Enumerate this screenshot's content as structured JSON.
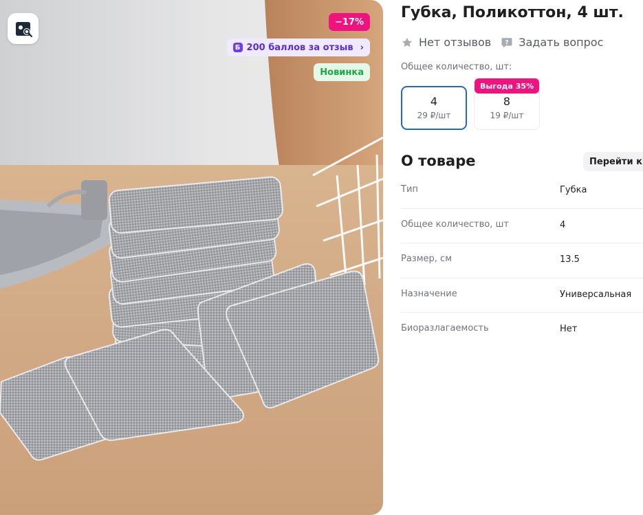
{
  "gallery": {
    "discount_badge": "−17%",
    "points_badge": {
      "icon_letter": "Б",
      "label": "200 баллов за отзыв",
      "chevron": "›"
    },
    "new_badge": "Новинка",
    "lens_icon": "image-search-icon"
  },
  "product": {
    "title": "Губка, Поликоттон, 4 шт.",
    "reviews_label": "Нет отзывов",
    "question_label": "Задать вопрос",
    "quantity_label": "Общее количество, шт:",
    "variants": [
      {
        "qty": "4",
        "price": "29 ₽/шт",
        "selected": true
      },
      {
        "qty": "8",
        "price": "19 ₽/шт",
        "selected": false,
        "promo": "Выгода 35%"
      }
    ]
  },
  "about": {
    "title": "О товаре",
    "goto_button": "Перейти к",
    "specs": [
      {
        "key": "Тип",
        "value": "Губка"
      },
      {
        "key": "Общее количество, шт",
        "value": "4"
      },
      {
        "key": "Размер, см",
        "value": "13.5"
      },
      {
        "key": "Назначение",
        "value": "Универсальная"
      },
      {
        "key": "Биоразлагаемость",
        "value": "Нет"
      }
    ]
  },
  "colors": {
    "discount": "#f0137f",
    "points_text": "#5a2ddb",
    "new_text": "#1aa844",
    "selected_border": "#1f66d6"
  }
}
